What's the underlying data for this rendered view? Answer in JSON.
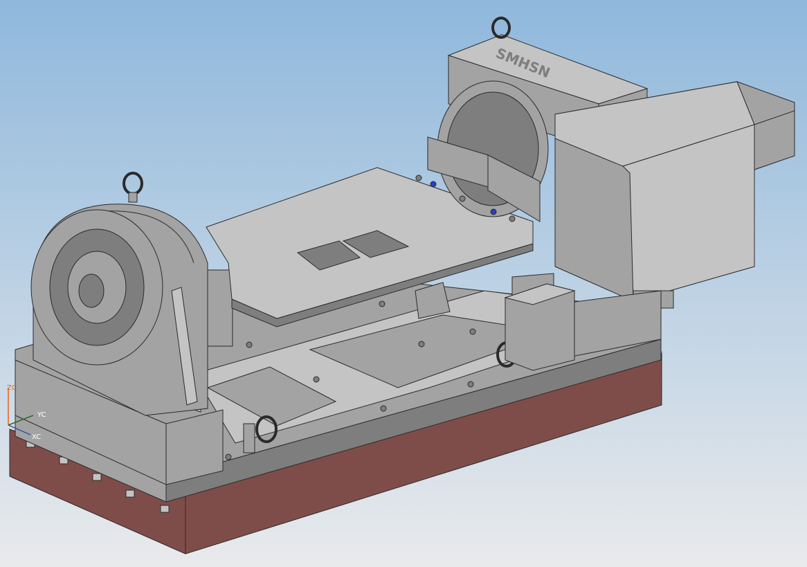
{
  "viewport": {
    "background_top": "#8fb8dc",
    "background_bottom": "#e9eaec"
  },
  "model": {
    "part_color": "#a3a3a3",
    "part_light": "#c4c4c4",
    "part_dark": "#7e7e7e",
    "edge_color": "#2a2a2a",
    "base_plate_color": "#7e4d4a",
    "base_plate_edge": "#d69a94",
    "hole_accent": "#2a3fbf",
    "brand_text": "SMHSN"
  },
  "triad": {
    "z_label": "ZC",
    "y_label": "YC",
    "x_label": "XC",
    "z_color": "#e0631b",
    "y_color": "#2e6b2e",
    "x_color": "#2f4fa0"
  }
}
